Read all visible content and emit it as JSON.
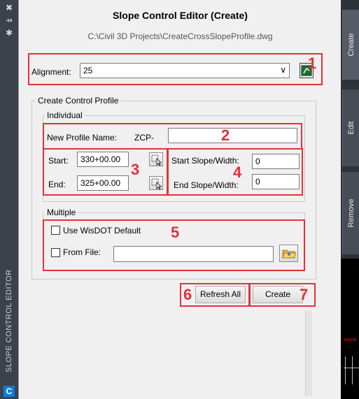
{
  "left_bar": {
    "vertical_title": "SLOPE CONTROL EDITOR",
    "close_glyph": "✖",
    "pin_glyph": "⇸",
    "settings_glyph": "✱",
    "logo_letter": "C"
  },
  "dialog": {
    "title": "Slope Control Editor (Create)",
    "file_path": "C:\\Civil 3D Projects\\CreateCrossSlopeProfile.dwg"
  },
  "alignment": {
    "label": "Alignment:",
    "selected": "25",
    "dropdown_arrow": "∨"
  },
  "create_control_profile": {
    "title": "Create Control Profile",
    "individual": {
      "title": "Individual",
      "new_profile_name_label": "New Profile Name:",
      "prefix": "ZCP-",
      "new_profile_name_value": "",
      "start_label": "Start:",
      "start_value": "330+00.00",
      "end_label": "End:",
      "end_value": "325+00.00",
      "start_slope_label": "Start Slope/Width:",
      "start_slope_value": "0",
      "end_slope_label": "End Slope/Width:",
      "end_slope_value": "0"
    },
    "multiple": {
      "title": "Multiple",
      "use_default_label": "Use WisDOT Default",
      "use_default_checked": false,
      "from_file_label": "From File:",
      "from_file_checked": false,
      "from_file_value": ""
    }
  },
  "buttons": {
    "refresh_all": "Refresh All",
    "create": "Create"
  },
  "tabs": [
    {
      "label": "Create"
    },
    {
      "label": "Edit"
    },
    {
      "label": "Remove"
    }
  ],
  "annotations": [
    "1",
    "2",
    "3",
    "4",
    "5",
    "6",
    "7"
  ],
  "cad_text": "ssscd",
  "colors": {
    "annotation_red": "#e5303a",
    "panel_bg": "#f0f0f0",
    "sidebar_dark": "#3c414b",
    "logo_blue": "#0a7fd6"
  }
}
